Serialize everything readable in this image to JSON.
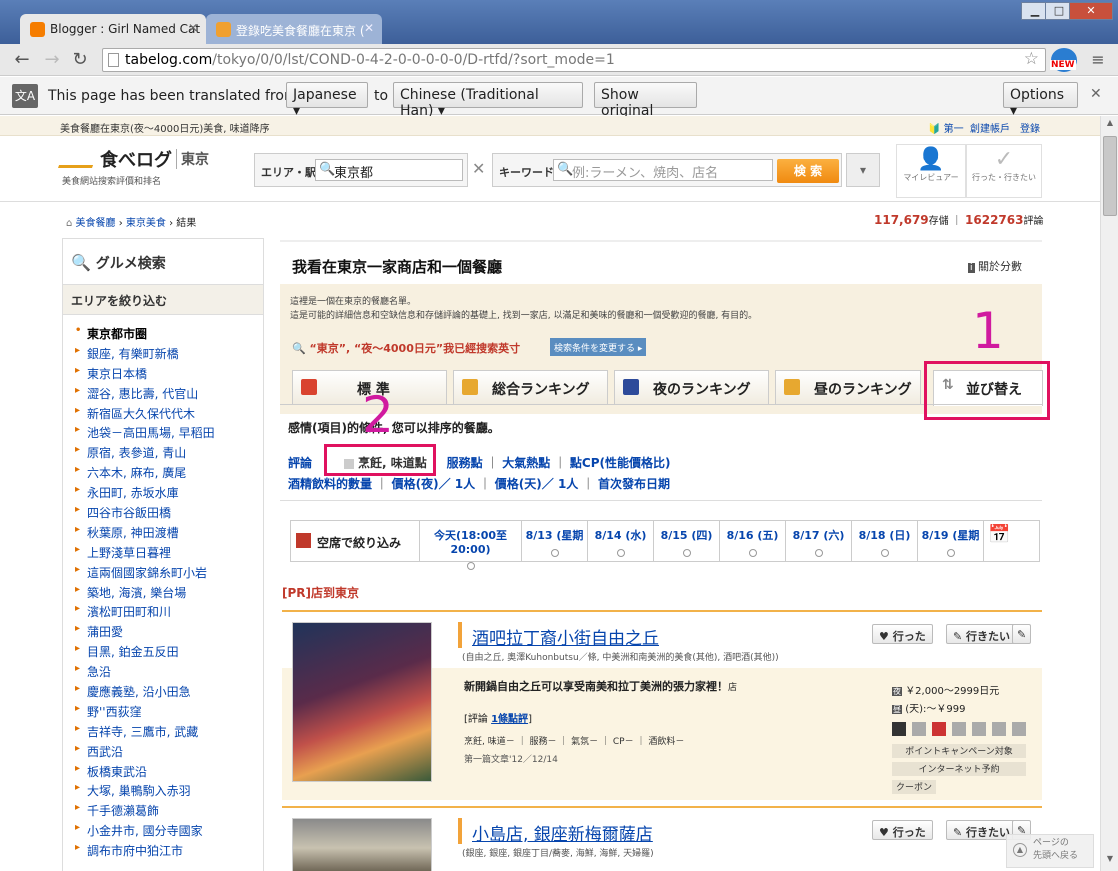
{
  "browser": {
    "tabs": [
      {
        "title": "Blogger : Girl Named Cat"
      },
      {
        "title": "登錄吃美食餐廳在東京 ("
      }
    ],
    "url_host": "tabelog.com",
    "url_path": "/tokyo/0/0/lst/COND-0-4-2-0-0-0-0-0/D-rtfd/?sort_mode=1",
    "new_badge": "NEW"
  },
  "translate_bar": {
    "prefix": "This page has been translated from",
    "from_lang": "Japanese",
    "to_word": "to",
    "to_lang": "Chinese (Traditional Han)",
    "show_original": "Show original",
    "options": "Options"
  },
  "site": {
    "top_strip_text": "美食餐廳在東京(夜～4000日元)美食, 味道降序",
    "top_links": [
      "第一",
      "創建帳戶",
      "登錄"
    ],
    "logo_text": "食べログ",
    "logo_region": "東京",
    "logo_sub": "美食網站搜索評價和排名",
    "area_label": "エリア・駅",
    "area_value": "東京都",
    "keyword_label": "キーワード",
    "keyword_placeholder": "例:ラーメン、焼肉、店名",
    "search_btn": "検 索",
    "my_review": "マイレビュアー",
    "went": "行った・行きたい",
    "breadcrumb": [
      "美食餐廳",
      "東京美食",
      "結果"
    ],
    "count_stores": "117,679",
    "count_stores_unit": "存儲",
    "count_reviews": "1622763",
    "count_reviews_unit": "評論"
  },
  "sidebar": {
    "title": "グルメ検索",
    "section": "エリアを絞り込む",
    "items": [
      "東京都市圈",
      "銀座, 有樂町新橋",
      "東京日本橋",
      "澀谷, 惠比壽, 代官山",
      "新宿區大久保代代木",
      "池袋－高田馬場, 早稻田",
      "原宿, 表參道, 青山",
      "六本木, 麻布, 廣尾",
      "永田町, 赤坂水庫",
      "四谷市谷飯田橋",
      "秋葉原, 神田渡槽",
      "上野淺草日暮裡",
      "這兩個國家錦糸町小岩",
      "築地, 海濱, 樂台場",
      "濱松町田町和川",
      "蒲田愛",
      "目黑, 鉑金五反田",
      "急沿",
      "慶應義塾, 沿小田急",
      "野''西荻窪",
      "吉祥寺, 三鷹市, 武藏",
      "西武沿",
      "板橋東武沿",
      "大塚, 巢鴨駒入赤羽",
      "千手德瀨葛飾",
      "小金井市, 國分寺國家",
      "調布市府中狛江市"
    ]
  },
  "main": {
    "title": "我看在東京一家商店和一個餐廳",
    "about_link": "關於分數",
    "desc1": "這裡是一個在東京的餐廳名單。",
    "desc2": "這是可能的詳細信息和空缺信息和存儲評論的基礎上, 找到一家店, 以滿足和美味的餐廳和一個受歡迎的餐廳, 有目的。",
    "search_done": "“東京”, “夜～4000日元”我已經搜索英寸",
    "change_cond_btn": "検索条件を変更する",
    "tabs": [
      "標 準",
      "総合ランキング",
      "夜のランキング",
      "昼のランキング",
      "並び替え"
    ],
    "sort_hint": "感情(項目)的條件, 您可以排序的餐廳。",
    "sort_links_row1": [
      "評論",
      "烹飪, 味道點",
      "服務點",
      "大氣熱點",
      "點CP(性能價格比)"
    ],
    "sort_links_row2": [
      "酒精飲料的數量",
      "價格(夜)／ 1人",
      "價格(天)／ 1人",
      "首次發布日期"
    ],
    "vacancy_label": "空席で絞り込み",
    "days": [
      "今天(18:00至20:00)",
      "8/13 (星期",
      "8/14 (水)",
      "8/15 (四)",
      "8/16 (五)",
      "8/17 (六)",
      "8/18 (日)",
      "8/19 (星期"
    ],
    "pr_label": "[PR]店到東京"
  },
  "restaurants": [
    {
      "name": "酒吧拉丁裔小街自由之丘",
      "meta": "(自由之丘, 奧澤Kuhonbutsu／條, 中美洲和南美洲的美食(其他), 酒吧酒(其他))",
      "headline": "新開鍋自由之丘可以享受南美和拉丁美洲的張力家裡！",
      "headline_suffix": "店",
      "review_label": "評論",
      "review_count": "1條點評",
      "scores": "烹飪, 味道－ ｜ 服務－ ｜ 氣氛－ ｜ CP－ ｜ 酒飲料－",
      "first_post": "第一篇文章'12／12/14",
      "price_night": "￥2,000～2999日元",
      "price_day": "(天):～￥999",
      "campaign": "ポイントキャンペーン対象",
      "internet": "インターネット予約",
      "coupon": "クーポン",
      "went_btn": "行った",
      "want_btn": "行きたい"
    },
    {
      "name": "小島店, 銀座新梅爾薩店",
      "meta": "(銀座, 銀座, 銀座丁目/蕎麥, 海鮮, 海鮮, 天婦羅)",
      "went_btn": "行った",
      "want_btn": "行きたい"
    }
  ],
  "annotations": {
    "one": "1",
    "two": "2"
  },
  "back_to_top": [
    "ページの",
    "先頭へ戻る"
  ],
  "colors": {
    "accent": "#f2a33a",
    "annot": "#e0115f",
    "link": "#0645ad"
  }
}
